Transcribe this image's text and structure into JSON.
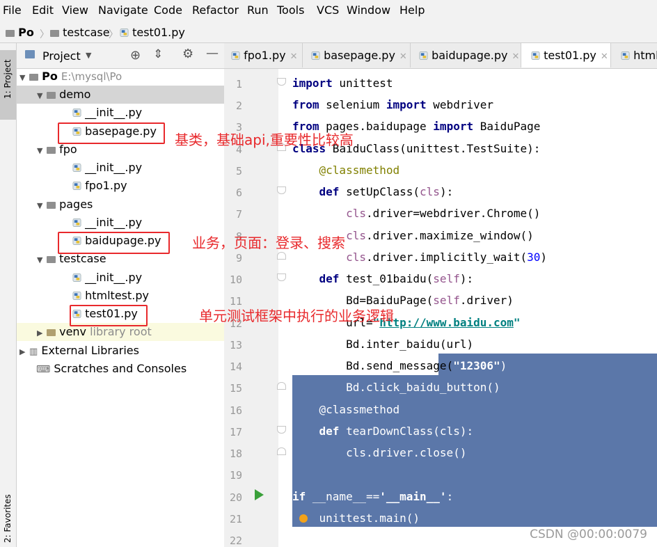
{
  "menu": [
    "File",
    "Edit",
    "View",
    "Navigate",
    "Code",
    "Refactor",
    "Run",
    "Tools",
    "VCS",
    "Window",
    "Help"
  ],
  "breadcrumb": [
    "Po",
    "testcase",
    "test01.py"
  ],
  "tool_windows": {
    "project": "1: Project",
    "favorites": "2: Favorites"
  },
  "project_panel": {
    "title": "Project",
    "tree": [
      {
        "label": "Po",
        "note": "E:\\mysql\\Po"
      },
      {
        "label": "demo"
      },
      {
        "label": "__init__.py"
      },
      {
        "label": "basepage.py"
      },
      {
        "label": "fpo"
      },
      {
        "label": "__init__.py"
      },
      {
        "label": "fpo1.py"
      },
      {
        "label": "pages"
      },
      {
        "label": "__init__.py"
      },
      {
        "label": "baidupage.py"
      },
      {
        "label": "testcase"
      },
      {
        "label": "__init__.py"
      },
      {
        "label": "htmltest.py"
      },
      {
        "label": "test01.py"
      },
      {
        "label": "venv",
        "note": "library root"
      },
      {
        "label": "External Libraries"
      },
      {
        "label": "Scratches and Consoles"
      }
    ]
  },
  "annotations": [
    "基类，基础api,重要性比较高",
    "业务，页面：登录、搜索",
    "单元测试框架中执行的业务逻辑"
  ],
  "tabs": [
    "fpo1.py",
    "basepage.py",
    "baidupage.py",
    "test01.py",
    "html"
  ],
  "active_tab": "test01.py",
  "line_numbers": [
    "1",
    "2",
    "3",
    "4",
    "5",
    "6",
    "7",
    "8",
    "9",
    "10",
    "11",
    "12",
    "13",
    "14",
    "15",
    "16",
    "17",
    "18",
    "19",
    "20",
    "21",
    "22"
  ],
  "code_lines": [
    "import unittest",
    "from selenium import webdriver",
    "from pages.baidupage import BaiduPage",
    "class BaiduClass(unittest.TestSuite):",
    "    @classmethod",
    "    def setUpClass(cls):",
    "        cls.driver=webdriver.Chrome()",
    "        cls.driver.maximize_window()",
    "        cls.driver.implicitly_wait(30)",
    "    def test_01baidu(self):",
    "        Bd=BaiduPage(self.driver)",
    "        url=\"http://www.baidu.com\"",
    "        Bd.inter_baidu(url)",
    "        Bd.send_message(\"12306\")",
    "        Bd.click_baidu_button()",
    "    @classmethod",
    "    def tearDownClass(cls):",
    "        cls.driver.close()",
    "",
    "if __name__=='__main__':",
    "    unittest.main()",
    ""
  ],
  "colors": {
    "selection": "#5b77a9",
    "annotation": "#e8292c",
    "keyword": "#000080"
  },
  "watermark": "CSDN @00:00:0079"
}
